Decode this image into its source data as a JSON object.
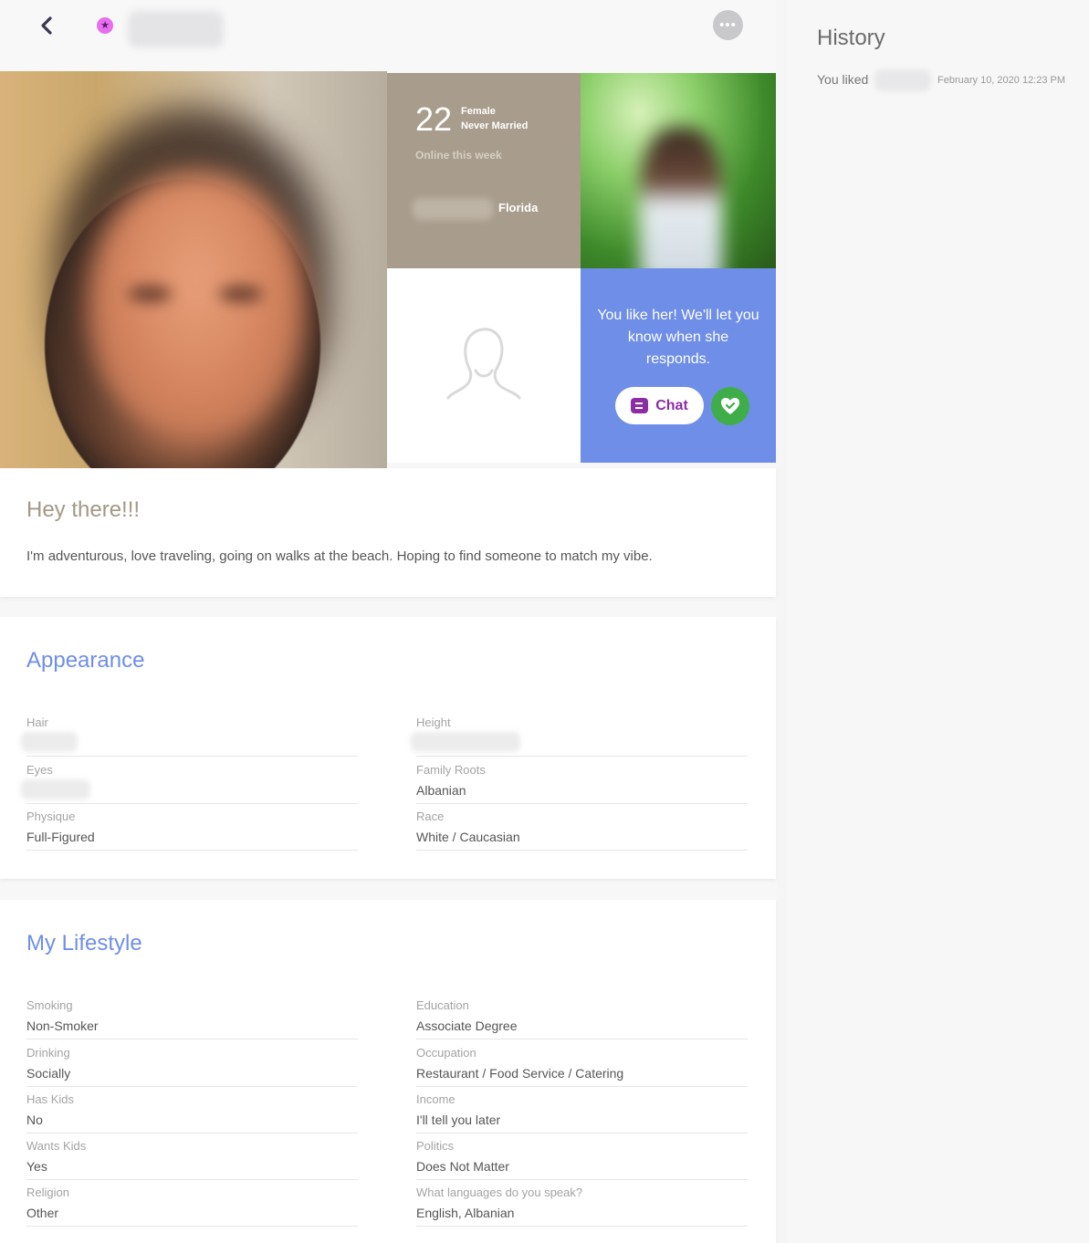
{
  "topbar": {
    "badge_icon": "star-icon"
  },
  "profile": {
    "age": "22",
    "gender": "Female",
    "marital_status": "Never Married",
    "online_status": "Online this week",
    "state": "Florida"
  },
  "like_tile": {
    "message": "You like her! We'll let you know when she responds.",
    "chat_label": "Chat",
    "color": "#6f8ee8"
  },
  "bio": {
    "title": "Hey there!!!",
    "text": "I'm adventurous, love traveling, going on walks at the beach. Hoping to find someone to match my vibe."
  },
  "appearance": {
    "title": "Appearance",
    "left": [
      {
        "label": "Hair",
        "value": ""
      },
      {
        "label": "Eyes",
        "value": ""
      },
      {
        "label": "Physique",
        "value": "Full-Figured"
      }
    ],
    "right": [
      {
        "label": "Height",
        "value": ""
      },
      {
        "label": "Family Roots",
        "value": "Albanian"
      },
      {
        "label": "Race",
        "value": "White / Caucasian"
      }
    ]
  },
  "lifestyle": {
    "title": "My Lifestyle",
    "left": [
      {
        "label": "Smoking",
        "value": "Non-Smoker"
      },
      {
        "label": "Drinking",
        "value": "Socially"
      },
      {
        "label": "Has Kids",
        "value": "No"
      },
      {
        "label": "Wants Kids",
        "value": "Yes"
      },
      {
        "label": "Religion",
        "value": "Other"
      }
    ],
    "right": [
      {
        "label": "Education",
        "value": "Associate Degree"
      },
      {
        "label": "Occupation",
        "value": "Restaurant / Food Service / Catering"
      },
      {
        "label": "Income",
        "value": "I'll tell you later"
      },
      {
        "label": "Politics",
        "value": "Does Not Matter"
      },
      {
        "label": "What languages do you speak?",
        "value": "English, Albanian"
      }
    ]
  },
  "history": {
    "title": "History",
    "liked_label": "You liked",
    "date": "February 10, 2020 12:23 PM"
  }
}
